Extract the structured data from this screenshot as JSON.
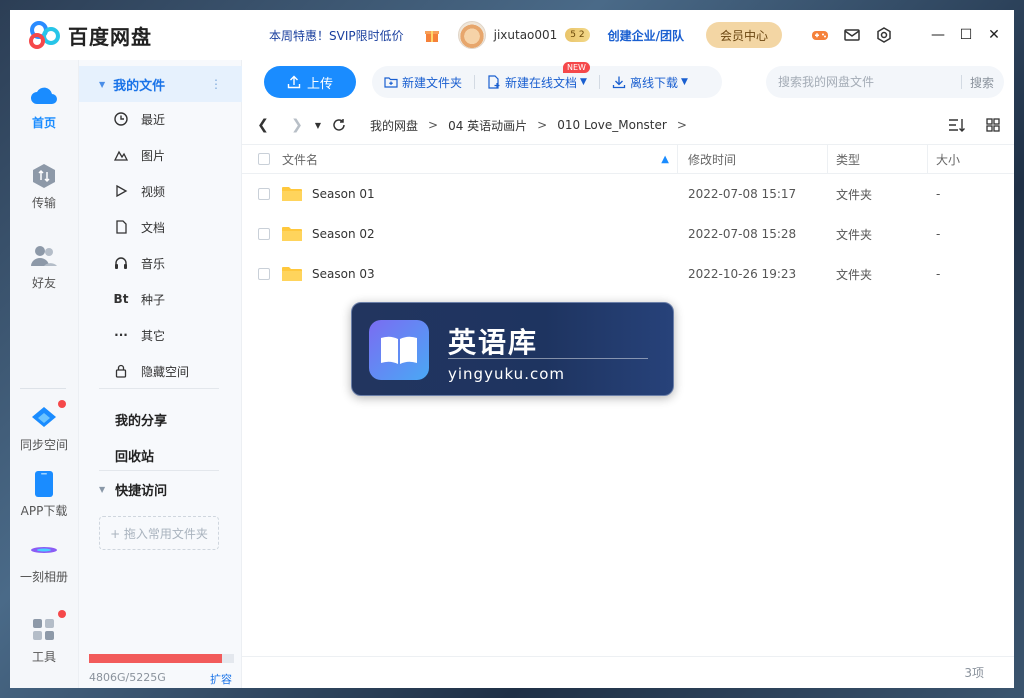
{
  "app": {
    "title": "百度网盘",
    "promo": "本周特惠！SVIP限时低价",
    "username": "jixutao001",
    "vip_badge": "5 2",
    "enterprise": "创建企业/团队",
    "member_center": "会员中心",
    "window_controls": {
      "minimize": "—",
      "maximize": "☐",
      "close": "✕"
    }
  },
  "rail": {
    "items": [
      {
        "label": "首页",
        "icon": "cloud-icon"
      },
      {
        "label": "传输",
        "icon": "transfer-icon"
      },
      {
        "label": "好友",
        "icon": "friends-icon"
      },
      {
        "label": "同步空间",
        "icon": "sync-icon"
      },
      {
        "label": "APP下载",
        "icon": "phone-icon"
      },
      {
        "label": "一刻相册",
        "icon": "album-icon"
      },
      {
        "label": "工具",
        "icon": "tools-icon"
      }
    ]
  },
  "sidebar": {
    "my_files": "我的文件",
    "items": [
      {
        "label": "最近",
        "icon": "clock-icon"
      },
      {
        "label": "图片",
        "icon": "image-icon"
      },
      {
        "label": "视频",
        "icon": "play-icon"
      },
      {
        "label": "文档",
        "icon": "document-icon"
      },
      {
        "label": "音乐",
        "icon": "headphones-icon"
      },
      {
        "label": "种子",
        "icon": "bt-icon",
        "glyph": "Bt"
      },
      {
        "label": "其它",
        "icon": "more-icon",
        "glyph": "···"
      },
      {
        "label": "隐藏空间",
        "icon": "lock-icon"
      }
    ],
    "my_share": "我的分享",
    "recycle": "回收站",
    "quick_access": "快捷访问",
    "drop_hint": "+ 拖入常用文件夹",
    "quota_text": "4806G/5225G",
    "quota_used_fraction": 0.92,
    "expand": "扩容"
  },
  "toolbar": {
    "upload": "上传",
    "new_folder": "新建文件夹",
    "new_online_doc": "新建在线文档",
    "new_badge": "NEW",
    "offline_download": "离线下载",
    "search_placeholder": "搜索我的网盘文件",
    "search_button": "搜索"
  },
  "breadcrumb": [
    "我的网盘",
    "04 英语动画片",
    "010 Love_Monster"
  ],
  "breadcrumb_sep": ">",
  "table": {
    "headers": {
      "name": "文件名",
      "modified": "修改时间",
      "type": "类型",
      "size": "大小"
    },
    "rows": [
      {
        "name": "Season 01",
        "modified": "2022-07-08 15:17",
        "type": "文件夹",
        "size": "-"
      },
      {
        "name": "Season 02",
        "modified": "2022-07-08 15:28",
        "type": "文件夹",
        "size": "-"
      },
      {
        "name": "Season 03",
        "modified": "2022-10-26 19:23",
        "type": "文件夹",
        "size": "-"
      }
    ]
  },
  "footer": {
    "count": "3项"
  },
  "watermark": {
    "title": "英语库",
    "url": "yingyuku.com"
  },
  "colors": {
    "accent": "#1a8cff",
    "folder": "#ffc83d",
    "quota": "#f25b5b",
    "badge": "#f5484a"
  }
}
